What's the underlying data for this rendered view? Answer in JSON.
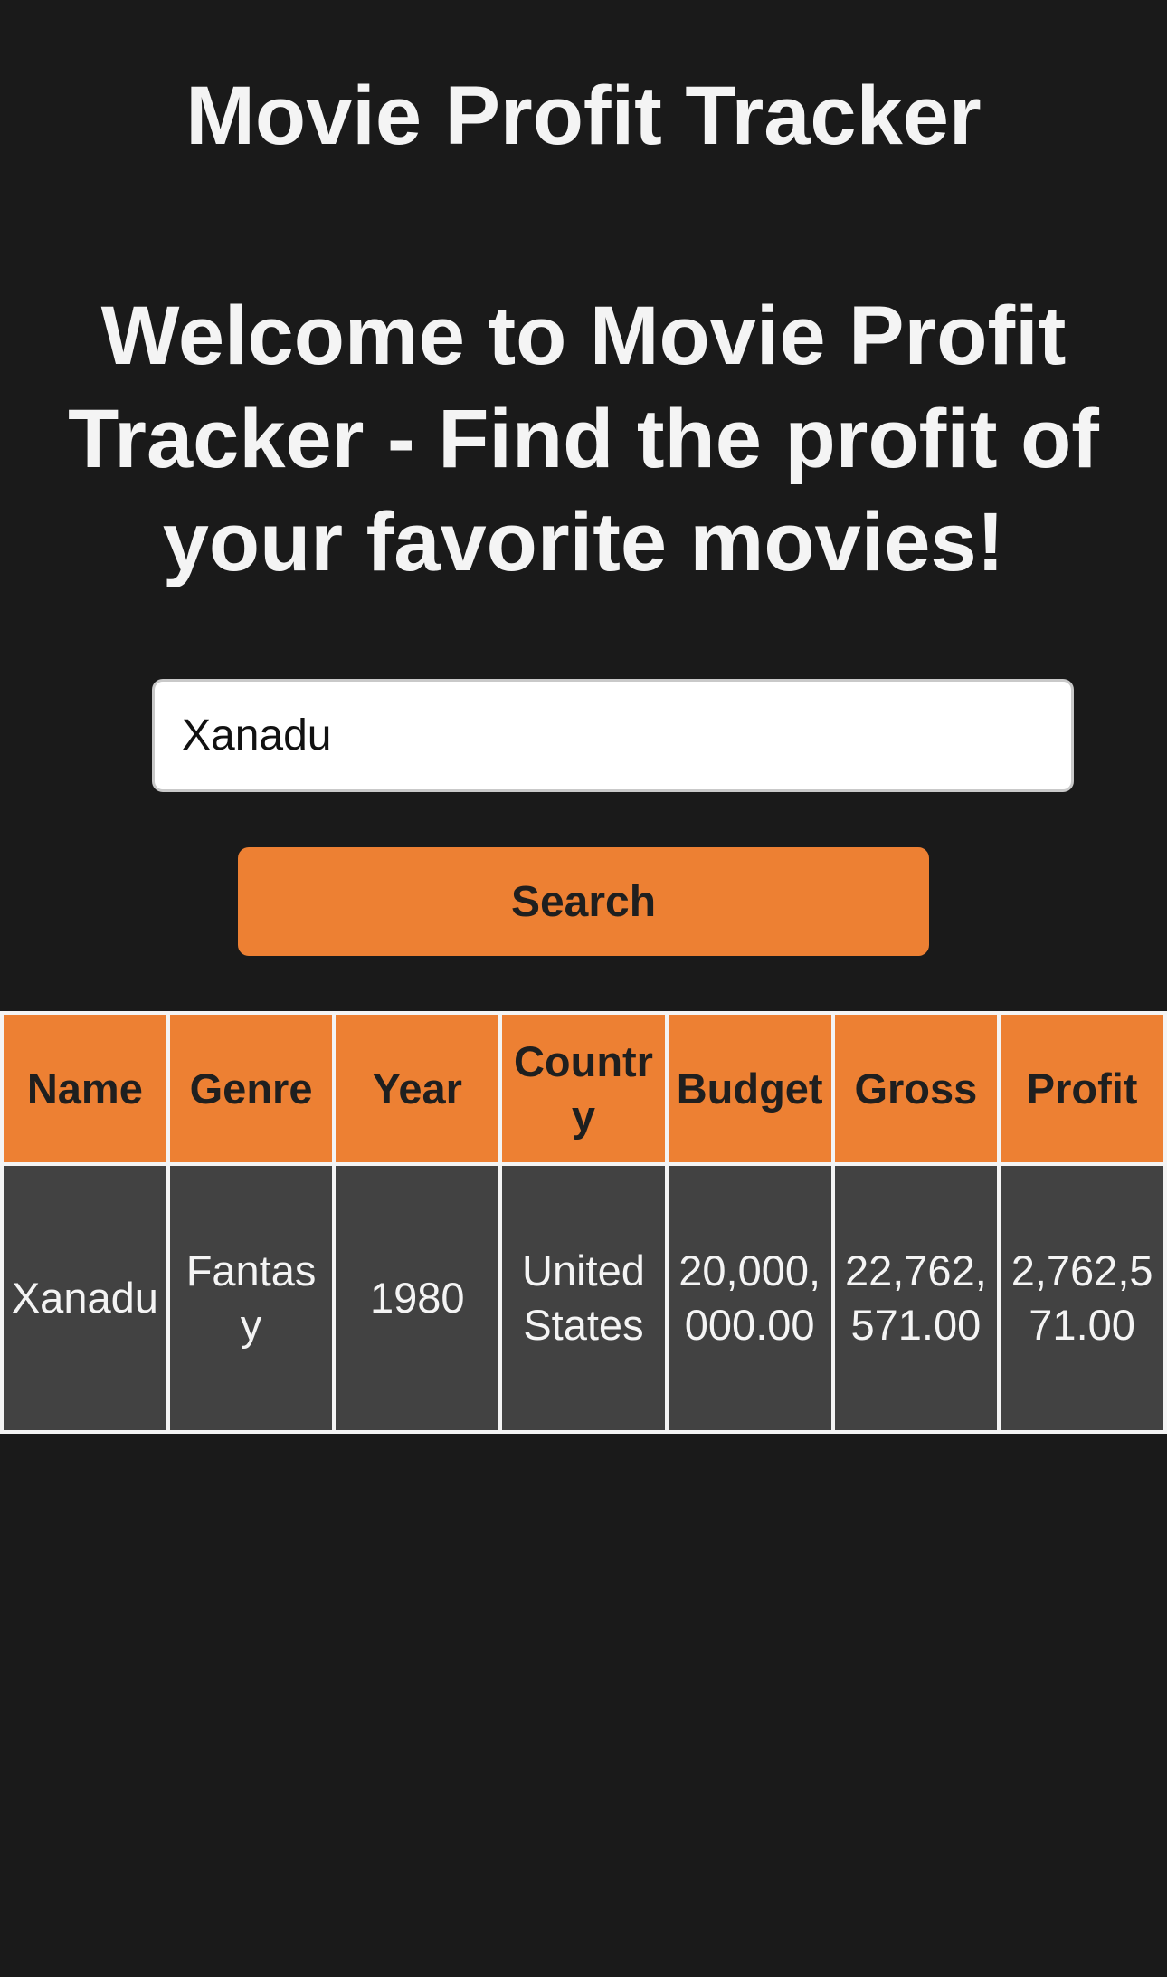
{
  "header": {
    "title": "Movie Profit Tracker"
  },
  "welcome": {
    "text": "Welcome to Movie Profit Tracker - Find the profit of your favorite movies!"
  },
  "search": {
    "value": "Xanadu",
    "button_label": "Search"
  },
  "table": {
    "headers": [
      "Name",
      "Genre",
      "Year",
      "Country",
      "Budget",
      "Gross",
      "Profit"
    ],
    "rows": [
      {
        "name": "Xanadu",
        "genre": "Fantasy",
        "year": "1980",
        "country": "United States",
        "budget": "20,000,000.00",
        "gross": "22,762,571.00",
        "profit": "2,762,571.00"
      }
    ]
  },
  "colors": {
    "background": "#1a1a1a",
    "accent": "#ed8033",
    "cell": "#424242",
    "text": "#f4f4f4"
  }
}
